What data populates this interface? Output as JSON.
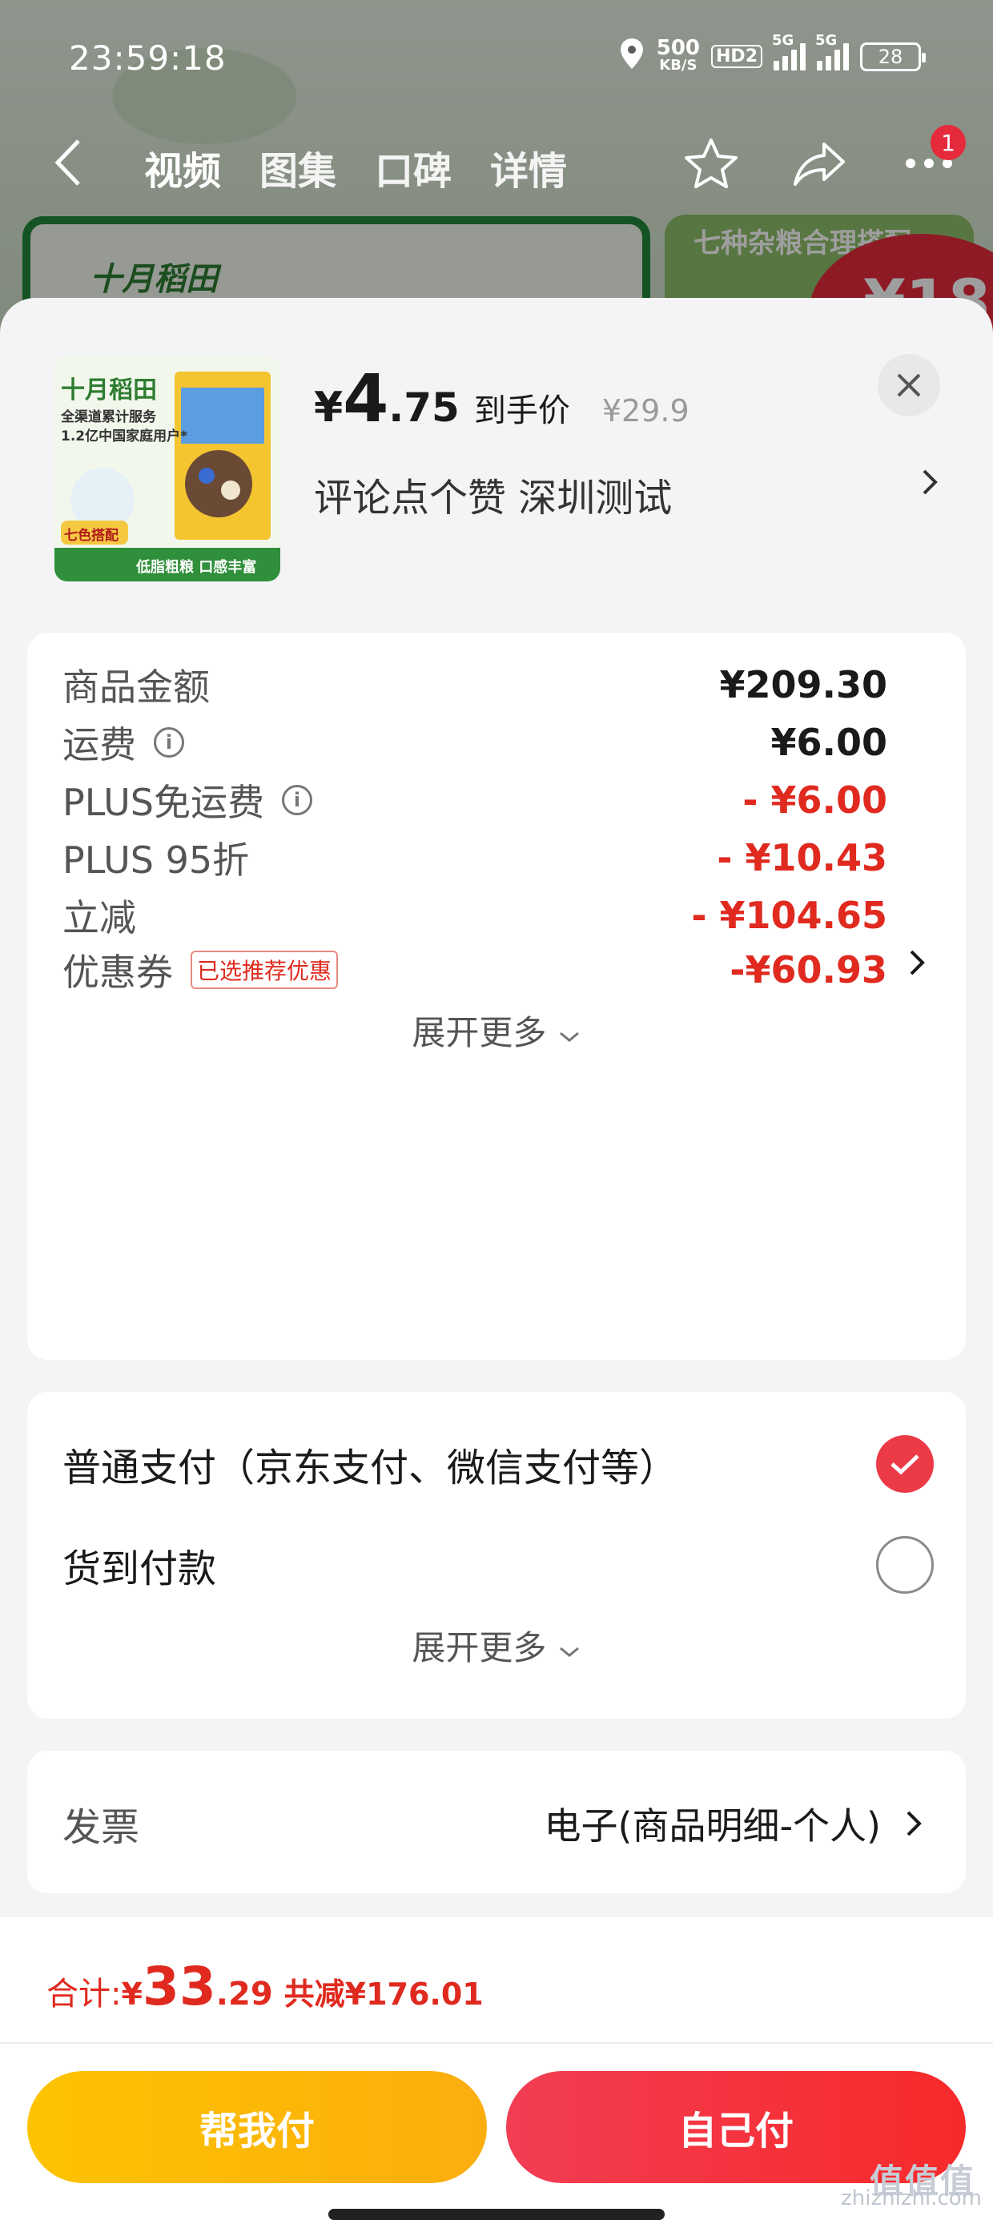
{
  "status_bar": {
    "time": "23:59:18",
    "net_speed": "500",
    "net_unit": "KB/S",
    "hd_label": "HD2",
    "signal1_label": "5G",
    "signal2_label": "5G",
    "battery": "28"
  },
  "nav": {
    "tabs": [
      "视频",
      "图集",
      "口碑",
      "详情"
    ],
    "active_tab": "视频",
    "cart_badge": "1"
  },
  "background": {
    "promo_text": "七种杂粮合理搭配",
    "price_fragment": "¥18",
    "brand_text": "十月稻田"
  },
  "product": {
    "image_brand": "十月稻田",
    "image_slogan_1": "全渠道累计服务",
    "image_slogan_2": "1.2亿中国家庭用户*",
    "image_tag": "七色搭配",
    "image_footer": "低脂粗粮 口感丰富",
    "currency": "¥",
    "price_int": "4",
    "price_dec": ".75",
    "price_label": "到手价",
    "original_price": "¥29.9",
    "address": "评论点个赞  深圳测试"
  },
  "fees": {
    "rows": [
      {
        "label": "商品金额",
        "value": "¥209.30",
        "red": false,
        "info": false
      },
      {
        "label": "运费",
        "value": "¥6.00",
        "red": false,
        "info": true
      },
      {
        "label": "PLUS免运费",
        "value": "- ¥6.00",
        "red": true,
        "info": true
      },
      {
        "label": "PLUS 95折",
        "value": "- ¥10.43",
        "red": true,
        "info": false
      },
      {
        "label": "立减",
        "value": "- ¥104.65",
        "red": true,
        "info": false
      }
    ],
    "coupon": {
      "label": "优惠券",
      "tag": "已选推荐优惠",
      "value": "-¥60.93"
    },
    "expand_label": "展开更多"
  },
  "payment": {
    "options": [
      {
        "label": "普通支付（京东支付、微信支付等）",
        "selected": true
      },
      {
        "label": "货到付款",
        "selected": false
      }
    ],
    "expand_label": "展开更多"
  },
  "invoice": {
    "label": "发票",
    "value": "电子(商品明细-个人)"
  },
  "footer": {
    "total_label": "合计:",
    "total_currency": "¥",
    "total_int": "33",
    "total_dec": ".29",
    "total_reduce": "共减¥176.01",
    "btn_help": "帮我付",
    "btn_self": "自己付"
  },
  "watermark": {
    "logo": "值值值",
    "site": "zhizhizhi.com"
  },
  "colors": {
    "accent_red": "#e02a1f",
    "check_red": "#ec3a47",
    "help_btn_yellow": "#fdc300",
    "self_btn_red": "#f23d53"
  }
}
